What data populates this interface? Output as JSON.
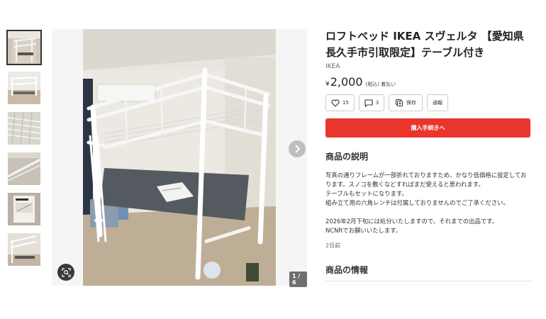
{
  "item": {
    "title": "ロフトベッド IKEA スヴェルタ 【愛知県長久手市引取限定】テーブル付き",
    "brand": "IKEA",
    "currency_symbol": "¥",
    "price": "2,000",
    "tax_note": "(税込) 着払い"
  },
  "actions": {
    "like_count": "15",
    "comment_count": "3",
    "save_label": "保存",
    "report_label": "通報"
  },
  "buy_button": "購入手続きへ",
  "description": {
    "heading": "商品の説明",
    "text": "写真の通りフレームが一部折れておりますため、かなり低価格に設定しております。スノコを敷くなどすればまだ使えると思われます。\nテーブルもセットになります。\n組み立て用の六角レンチは付属しておりませんのでご了承ください。\n\n2026年2月下旬には処分いたしますので、それまでの出品です。\nNCNRでお願いいたします。",
    "posted": "2日前"
  },
  "details_heading": "商品の情報",
  "gallery": {
    "counter": "1 / 6",
    "thumbnails": [
      "loft-bed-full",
      "loft-bed-side",
      "bed-slats",
      "frame-detail",
      "manual-cover",
      "bed-angle"
    ],
    "active_index": 0
  },
  "icons": [
    "heart-icon",
    "comment-icon",
    "save-icon",
    "zoom-icon",
    "chevron-right-icon"
  ],
  "colors": {
    "buy_button": "#ea352d",
    "text": "#222222"
  }
}
